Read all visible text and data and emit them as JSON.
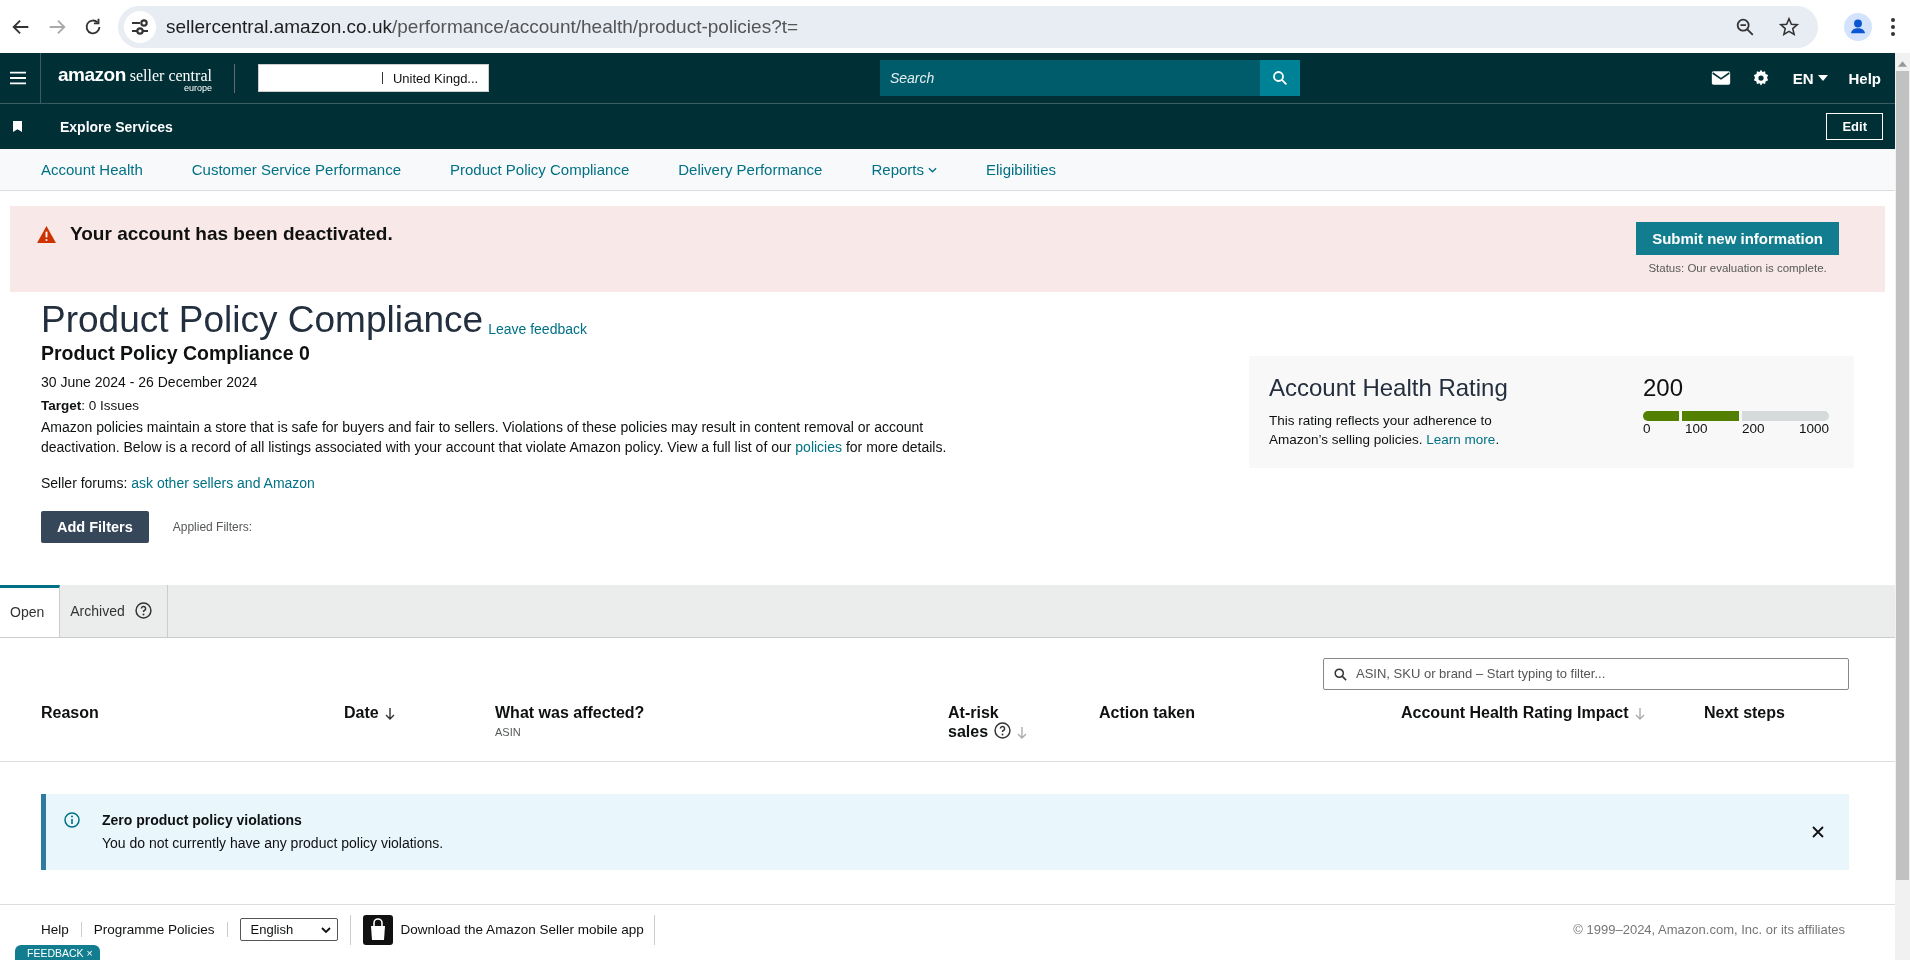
{
  "browser": {
    "url_host": "sellercentral.amazon.co.uk",
    "url_path": "/performance/account/health/product-policies?t="
  },
  "header": {
    "logo_text": "amazon",
    "logo_sub": "seller central",
    "logo_region": "europe",
    "store_region": "United Kingd...",
    "search_placeholder": "Search",
    "language": "EN",
    "help": "Help"
  },
  "services_bar": {
    "label": "Explore Services",
    "edit": "Edit"
  },
  "nav": [
    {
      "label": "Account Health",
      "dropdown": false
    },
    {
      "label": "Customer Service Performance",
      "dropdown": false
    },
    {
      "label": "Product Policy Compliance",
      "dropdown": false
    },
    {
      "label": "Delivery Performance",
      "dropdown": false
    },
    {
      "label": "Reports",
      "dropdown": true
    },
    {
      "label": "Eligibilities",
      "dropdown": false
    }
  ],
  "alert": {
    "message": "Your account has been deactivated.",
    "button": "Submit new information",
    "status": "Status: Our evaluation is complete."
  },
  "page": {
    "title": "Product Policy Compliance",
    "feedback_link": "Leave feedback",
    "subtitle": "Product Policy Compliance 0",
    "date_range": "30 June 2024 - 26 December 2024",
    "target": "**Target**: 0 Issues",
    "description": "Amazon policies maintain a store that is safe for buyers and fair to sellers. Violations of these policies may result in content removal or account deactivation. Below is a record of all listings associated with your account that violate Amazon policy. View a full list of our",
    "description_link": "policies",
    "description_end": "for more details.",
    "forums_label": "Seller forums:",
    "forums_link": "ask other sellers and Amazon",
    "add_filters": "Add Filters",
    "applied_filters": "Applied Filters:"
  },
  "rating": {
    "title": "Account Health Rating",
    "text": "This rating reflects your adherence to Amazon’s selling policies.",
    "link": "Learn more",
    "text_end": ".",
    "value": "200",
    "segments": [
      {
        "filled": true
      },
      {
        "filled": true
      },
      {
        "filled": false
      }
    ],
    "scale": [
      "0",
      "100",
      "200",
      "1000"
    ]
  },
  "tabs": [
    {
      "label": "Open",
      "selected": true,
      "help": false
    },
    {
      "label": "Archived",
      "selected": false,
      "help": true
    }
  ],
  "filter": {
    "placeholder": "ASIN, SKU or brand – Start typing to filter..."
  },
  "table": {
    "columns": [
      {
        "label": "Reason",
        "sort": false,
        "help": false
      },
      {
        "label": "Date",
        "sort": true,
        "help": false
      },
      {
        "label": "What was affected?",
        "sub": "ASIN",
        "sort": false,
        "help": false
      },
      {
        "label": "At-risk sales",
        "sort": true,
        "help": true
      },
      {
        "label": "Action taken",
        "sort": false,
        "help": false
      },
      {
        "label": "Account Health Rating Impact",
        "sort": true,
        "help": false
      },
      {
        "label": "Next steps",
        "sort": false,
        "help": false
      }
    ]
  },
  "info": {
    "title": "Zero product policy violations",
    "text": "You do not currently have any product policy violations."
  },
  "footer": {
    "links": [
      "Help",
      "Programme Policies"
    ],
    "language": "English",
    "app_link": "Download the Amazon Seller mobile app",
    "copyright": "© 1999–2024, Amazon.com, Inc. or its affiliates"
  },
  "feedback_tab": {
    "label": "FEEDBACK",
    "close": "×"
  }
}
